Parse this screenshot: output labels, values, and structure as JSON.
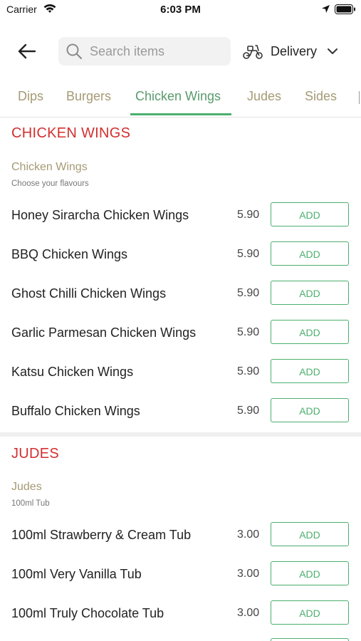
{
  "status_bar": {
    "carrier": "Carrier",
    "time": "6:03 PM"
  },
  "header": {
    "search_placeholder": "Search items",
    "delivery_label": "Delivery"
  },
  "tabs": [
    {
      "label": "Dips"
    },
    {
      "label": "Burgers"
    },
    {
      "label": "Chicken Wings"
    },
    {
      "label": "Judes"
    },
    {
      "label": "Sides"
    }
  ],
  "sections": [
    {
      "title": "CHICKEN WINGS",
      "subtitle": "Chicken Wings",
      "description": "Choose your flavours",
      "items": [
        {
          "name": "Honey Sirarcha Chicken Wings",
          "price": "5.90",
          "button": "ADD"
        },
        {
          "name": "BBQ Chicken Wings",
          "price": "5.90",
          "button": "ADD"
        },
        {
          "name": "Ghost Chilli Chicken Wings",
          "price": "5.90",
          "button": "ADD"
        },
        {
          "name": "Garlic Parmesan Chicken Wings",
          "price": "5.90",
          "button": "ADD"
        },
        {
          "name": "Katsu Chicken Wings",
          "price": "5.90",
          "button": "ADD"
        },
        {
          "name": "Buffalo Chicken Wings",
          "price": "5.90",
          "button": "ADD"
        }
      ]
    },
    {
      "title": "JUDES",
      "subtitle": "Judes",
      "description": "100ml Tub",
      "items": [
        {
          "name": "100ml Strawberry & Cream Tub",
          "price": "3.00",
          "button": "ADD"
        },
        {
          "name": "100ml Very Vanilla Tub",
          "price": "3.00",
          "button": "ADD"
        },
        {
          "name": "100ml Truly Chocolate Tub",
          "price": "3.00",
          "button": "ADD"
        }
      ]
    }
  ],
  "colors": {
    "accent_green": "#4caf6e",
    "section_red": "#d32f2f",
    "tab_inactive": "#a59a74"
  },
  "icons": [
    "wifi-icon",
    "location-arrow-icon",
    "battery-icon",
    "back-arrow-icon",
    "search-icon",
    "scooter-icon",
    "chevron-down-icon"
  ]
}
